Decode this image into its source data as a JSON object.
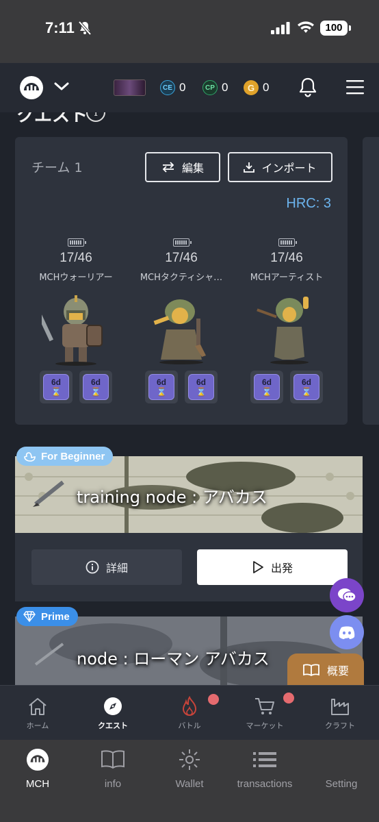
{
  "status_bar": {
    "time": "7:11",
    "battery": "100"
  },
  "header": {
    "currencies": [
      {
        "icon": "ce-coin-icon",
        "symbol": "CE",
        "value": "0",
        "color": "#3aa7e0"
      },
      {
        "icon": "cp-coin-icon",
        "symbol": "CP",
        "value": "0",
        "color": "#2fa86a"
      },
      {
        "icon": "gold-coin-icon",
        "symbol": "G",
        "value": "0",
        "color": "#e0a22a"
      }
    ]
  },
  "quest": {
    "title": "クエスト",
    "team": {
      "name": "チーム 1",
      "edit_label": "編集",
      "import_label": "インポート",
      "hrc": "HRC: 3",
      "units": [
        {
          "count": "17/46",
          "name": "MCHウォーリアー",
          "badges": [
            "6d",
            "6d"
          ]
        },
        {
          "count": "17/46",
          "name": "MCHタクティシャ…",
          "badges": [
            "6d",
            "6d"
          ]
        },
        {
          "count": "17/46",
          "name": "MCHアーティスト",
          "badges": [
            "6d",
            "6d"
          ]
        }
      ]
    },
    "nodes": [
      {
        "tag": "For Beginner",
        "tag_color": "#8ec5f2",
        "title": "training node : アバカス",
        "detail_label": "詳細",
        "start_label": "出発"
      },
      {
        "tag": "Prime",
        "tag_color": "#3b8fe8",
        "title": "node : ローマン アバカス"
      }
    ],
    "overview_label": "概要"
  },
  "app_nav": [
    {
      "label": "ホーム",
      "icon": "home-icon",
      "active": false
    },
    {
      "label": "クエスト",
      "icon": "compass-icon",
      "active": true
    },
    {
      "label": "バトル",
      "icon": "flame-icon",
      "active": false,
      "notify": true
    },
    {
      "label": "マーケット",
      "icon": "cart-icon",
      "active": false,
      "notify": true
    },
    {
      "label": "クラフト",
      "icon": "factory-icon",
      "active": false
    }
  ],
  "wallet_nav": [
    {
      "label": "MCH",
      "icon": "mch-logo-icon",
      "active": true
    },
    {
      "label": "info",
      "icon": "book-icon",
      "active": false
    },
    {
      "label": "Wallet",
      "icon": "sparkle-icon",
      "active": false
    },
    {
      "label": "transactions",
      "icon": "list-icon",
      "active": false
    },
    {
      "label": "Setting",
      "icon": "settings-icon",
      "active": false
    }
  ]
}
